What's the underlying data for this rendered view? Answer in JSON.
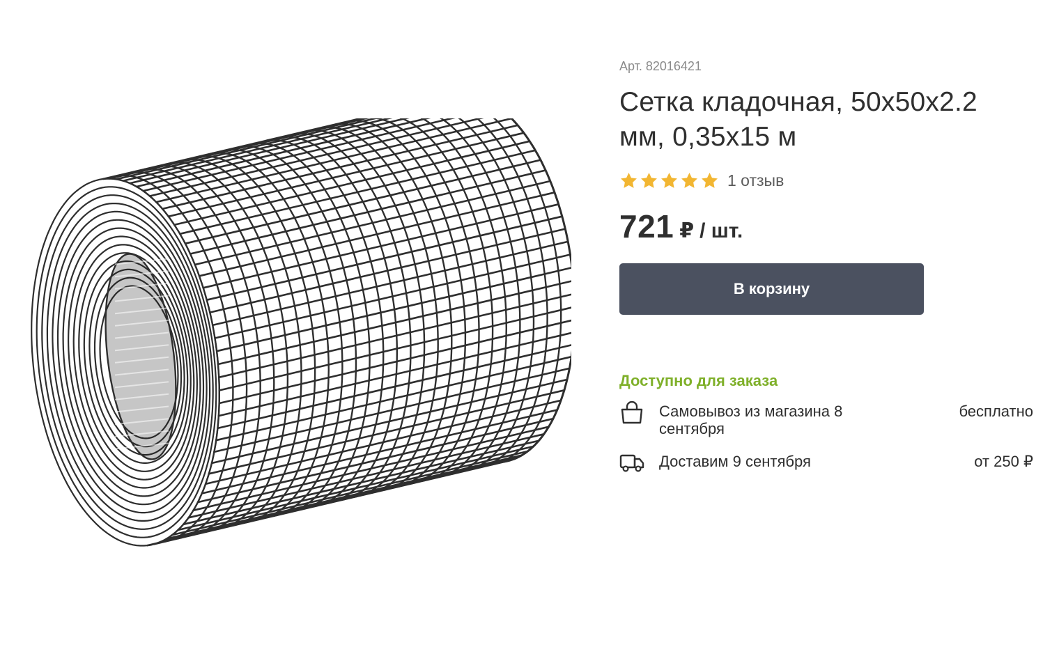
{
  "product": {
    "image_alt": "Сетка кладочная рулон",
    "sku": "Арт. 82016421",
    "title": "Сетка кладочная, 50х50х2.2 мм, 0,35х15 м",
    "rating": 5,
    "reviews_label": "1 отзыв",
    "price": {
      "value": "721",
      "currency": "₽",
      "unit": "/ шт."
    }
  },
  "actions": {
    "cart_label": "В корзину"
  },
  "availability": {
    "label": "Доступно для заказа",
    "options": [
      {
        "icon": "shopping-bag-icon",
        "text": "Самовывоз из магазина 8 сентября",
        "price": "бесплатно"
      },
      {
        "icon": "delivery-truck-icon",
        "text": "Доставим 9 сентября",
        "price": "от 250 ₽"
      }
    ]
  },
  "colors": {
    "star": "#f2b632",
    "button": "#4b5160",
    "available": "#7fb02a"
  }
}
